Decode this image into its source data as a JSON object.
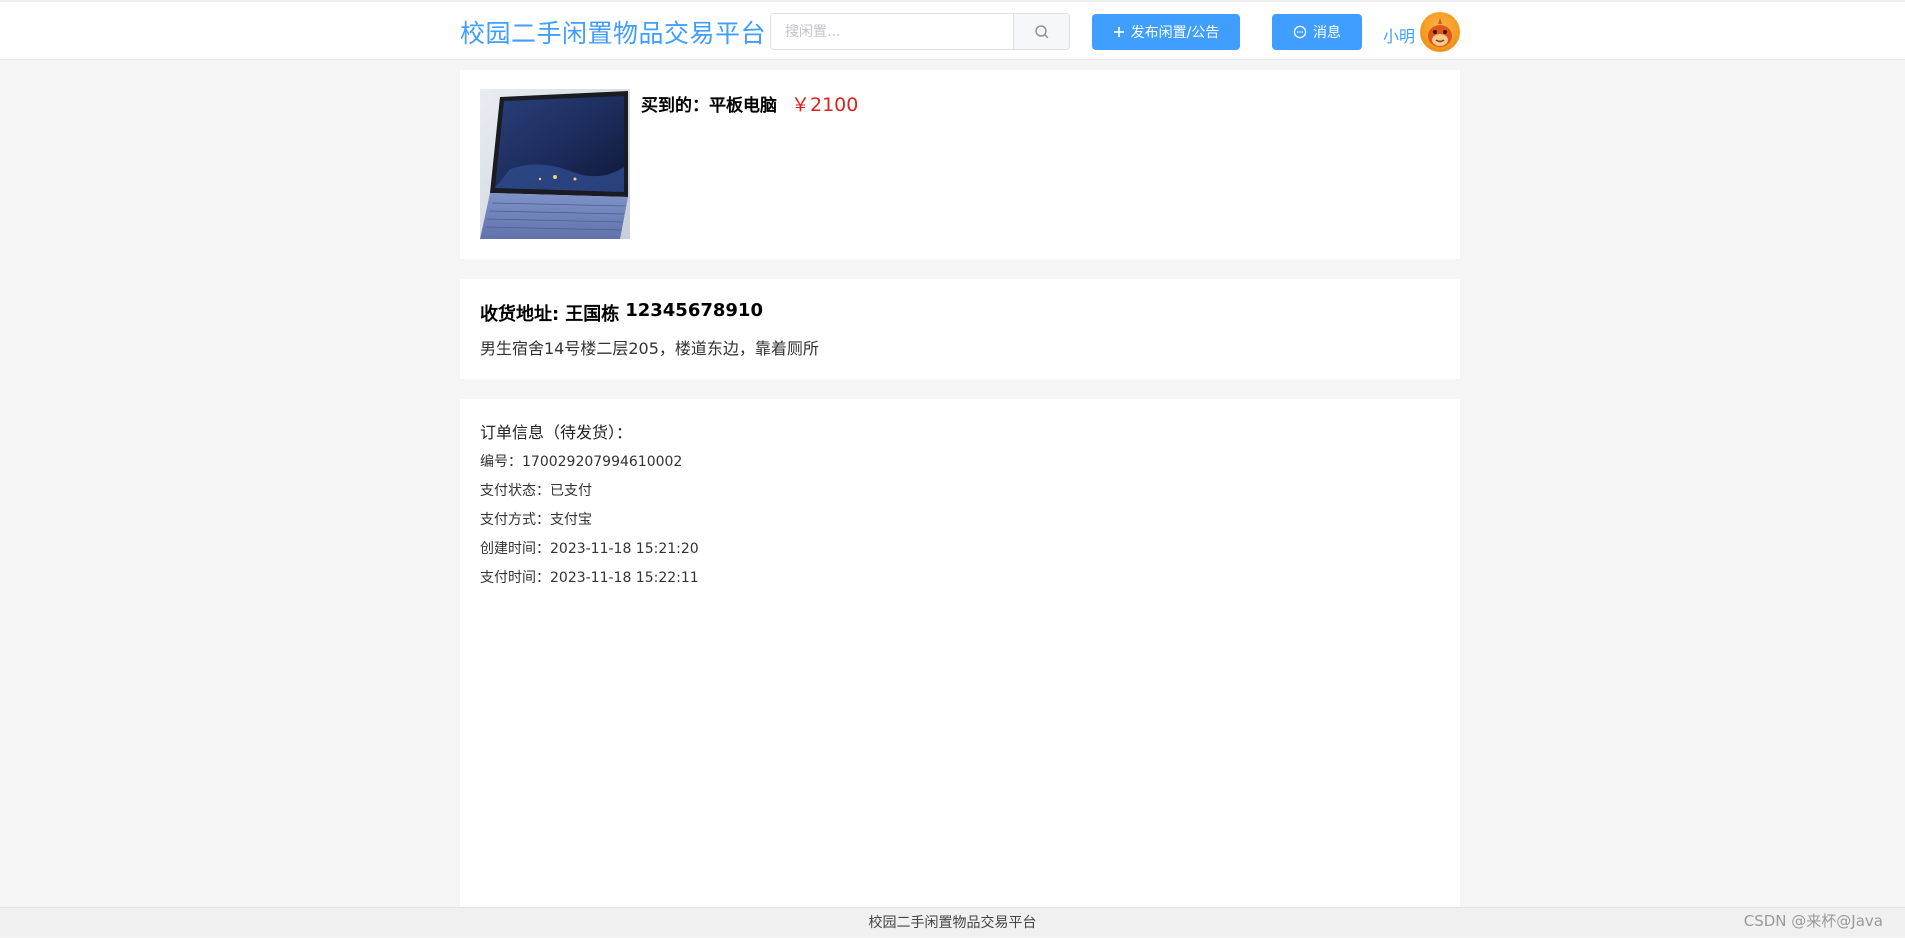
{
  "header": {
    "site_title": "校园二手闲置物品交易平台",
    "search_placeholder": "搜闲置...",
    "search_icon": "search-icon",
    "publish_label": "发布闲置/公告",
    "publish_icon": "plus-icon",
    "message_label": "消息",
    "message_icon": "chat-bubble-icon",
    "username": "小明",
    "avatar_icon": "avatar-icon"
  },
  "product": {
    "bought_label": "买到的：",
    "name": "平板电脑",
    "price": "￥2100",
    "image_icon": "tablet-photo"
  },
  "address": {
    "label": "收货地址:",
    "recipient": "王国栋",
    "phone": "12345678910",
    "detail": "男生宿舍14号楼二层205，楼道东边，靠着厕所"
  },
  "order": {
    "title": "订单信息（待发货）：",
    "rows": [
      "编号：170029207994610002",
      "支付状态：已支付",
      "支付方式：支付宝",
      "创建时间：2023-11-18 15:21:20",
      "支付时间：2023-11-18 15:22:11"
    ]
  },
  "footer": {
    "text": "校园二手闲置物品交易平台",
    "watermark": "CSDN @来杯@Java"
  },
  "colors": {
    "accent": "#409eff",
    "price": "#e02020",
    "background": "#f5f5f5"
  }
}
